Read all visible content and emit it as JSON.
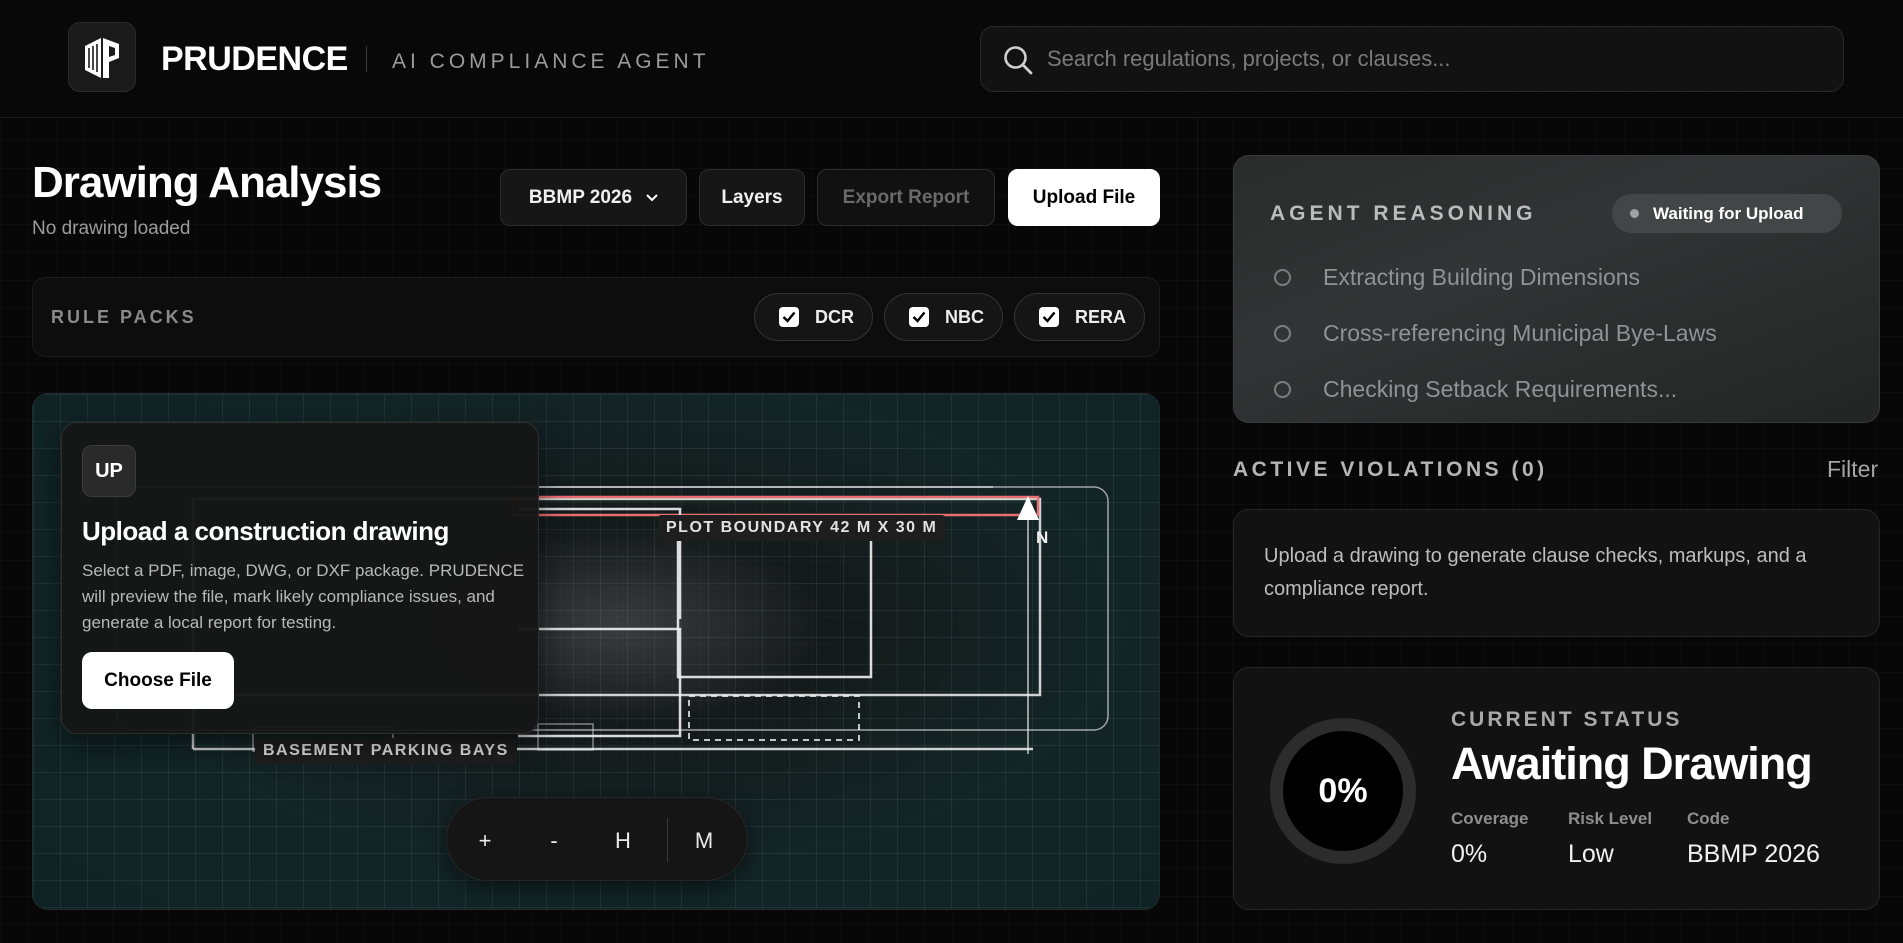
{
  "header": {
    "brand": "PRUDENCE",
    "subtitle": "AI COMPLIANCE AGENT",
    "search_placeholder": "Search regulations, projects, or clauses..."
  },
  "analysis": {
    "title": "Drawing Analysis",
    "subtitle": "No drawing loaded",
    "code_select": "BBMP 2026",
    "layers_label": "Layers",
    "export_label": "Export Report",
    "upload_label": "Upload File"
  },
  "rule_packs": {
    "label": "RULE PACKS",
    "items": [
      {
        "label": "DCR",
        "checked": true
      },
      {
        "label": "NBC",
        "checked": true
      },
      {
        "label": "RERA",
        "checked": true
      }
    ]
  },
  "canvas": {
    "plot_label": "PLOT BOUNDARY 42 M X 30 M",
    "parking_label": "BASEMENT PARKING BAYS",
    "north_label": "N",
    "upload_card": {
      "badge": "UP",
      "title": "Upload a construction drawing",
      "description": "Select a PDF, image, DWG, or DXF package. PRUDENCE will preview the file, mark likely compliance issues, and generate a local report for testing.",
      "button": "Choose File"
    },
    "zoom": {
      "plus": "+",
      "minus": "-",
      "home": "H",
      "measure": "M"
    }
  },
  "reasoning": {
    "title": "AGENT REASONING",
    "status": "Waiting for Upload",
    "steps": [
      "Extracting Building Dimensions",
      "Cross-referencing Municipal Bye-Laws",
      "Checking Setback Requirements..."
    ]
  },
  "violations": {
    "title": "ACTIVE VIOLATIONS (0)",
    "filter": "Filter",
    "empty_text": "Upload a drawing to generate clause checks, markups, and a compliance report."
  },
  "status": {
    "progress": "0%",
    "progress_value": 0,
    "label": "CURRENT STATUS",
    "title": "Awaiting Drawing",
    "metrics": [
      {
        "label": "Coverage",
        "value": "0%"
      },
      {
        "label": "Risk Level",
        "value": "Low"
      },
      {
        "label": "Code",
        "value": "BBMP 2026"
      }
    ]
  },
  "colors": {
    "background": "#070707",
    "accent": "#ffffff",
    "plot_boundary": "#e86f6f"
  }
}
